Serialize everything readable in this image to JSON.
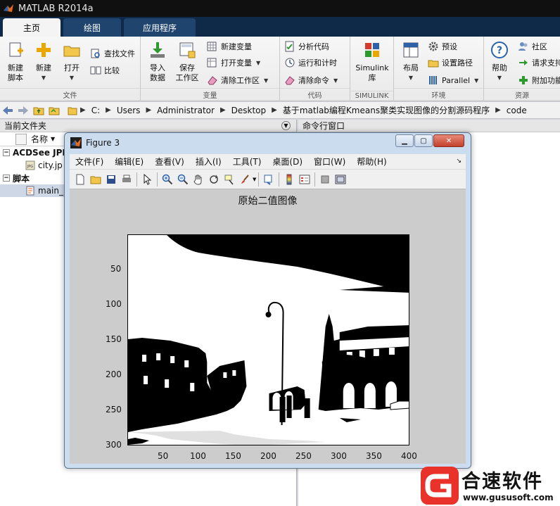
{
  "window": {
    "title": "MATLAB R2014a"
  },
  "tabs": [
    {
      "label": "主页",
      "active": true
    },
    {
      "label": "绘图"
    },
    {
      "label": "应用程序"
    }
  ],
  "ribbon": {
    "file": {
      "group_label": "文件",
      "new_script": [
        "新建",
        "脚本"
      ],
      "new": "新建",
      "open": "打开",
      "find_files": "查找文件",
      "compare": "比较"
    },
    "variable": {
      "group_label": "变量",
      "import_data": [
        "导入",
        "数据"
      ],
      "save_workspace": [
        "保存",
        "工作区"
      ],
      "new_variable": "新建变量",
      "open_variable": "打开变量",
      "clear_workspace": "清除工作区"
    },
    "code": {
      "group_label": "代码",
      "analyze_code": "分析代码",
      "run_and_time": "运行和计时",
      "clear_commands": "清除命令"
    },
    "simulink": {
      "group_label": "SIMULINK",
      "library": [
        "Simulink",
        "库"
      ]
    },
    "environment": {
      "group_label": "环境",
      "layout": "布局",
      "preferences": "预设",
      "set_path": "设置路径",
      "parallel": "Parallel"
    },
    "resources": {
      "group_label": "资源",
      "help": "帮助",
      "community": "社区",
      "request_support": "请求支持",
      "addons": "附加功能"
    }
  },
  "address": {
    "crumbs": [
      "C:",
      "Users",
      "Administrator",
      "Desktop",
      "基于matlab编程Kmeans聚类实现图像的分割源码程序",
      "code"
    ]
  },
  "current_folder": {
    "title": "当前文件夹",
    "name_col": "名称",
    "tree": [
      {
        "label": "ACDSee JPE",
        "type": "group"
      },
      {
        "label": "city.jp",
        "type": "file"
      },
      {
        "label": "脚本",
        "type": "group"
      },
      {
        "label": "main_",
        "type": "file",
        "selected": true
      }
    ]
  },
  "command_window": {
    "title": "命令行窗口"
  },
  "figure": {
    "title": "Figure 3",
    "menu": [
      "文件(F)",
      "编辑(E)",
      "查看(V)",
      "插入(I)",
      "工具(T)",
      "桌面(D)",
      "窗口(W)",
      "帮助(H)"
    ],
    "axes_title": "原始二值图像",
    "xticks": [
      "50",
      "100",
      "150",
      "200",
      "250",
      "300",
      "350",
      "400"
    ],
    "yticks": [
      "50",
      "100",
      "150",
      "200",
      "250",
      "300"
    ],
    "xlim": [
      0,
      400
    ],
    "ylim": [
      0,
      300
    ]
  },
  "watermark": {
    "name": "合速软件",
    "url": "www.gususoft.com",
    "accent": "#e8322a"
  },
  "colors": {
    "tab_bar": "#0f2a48",
    "title_bar": "#101010",
    "ribbon": "#f1f1f1"
  }
}
